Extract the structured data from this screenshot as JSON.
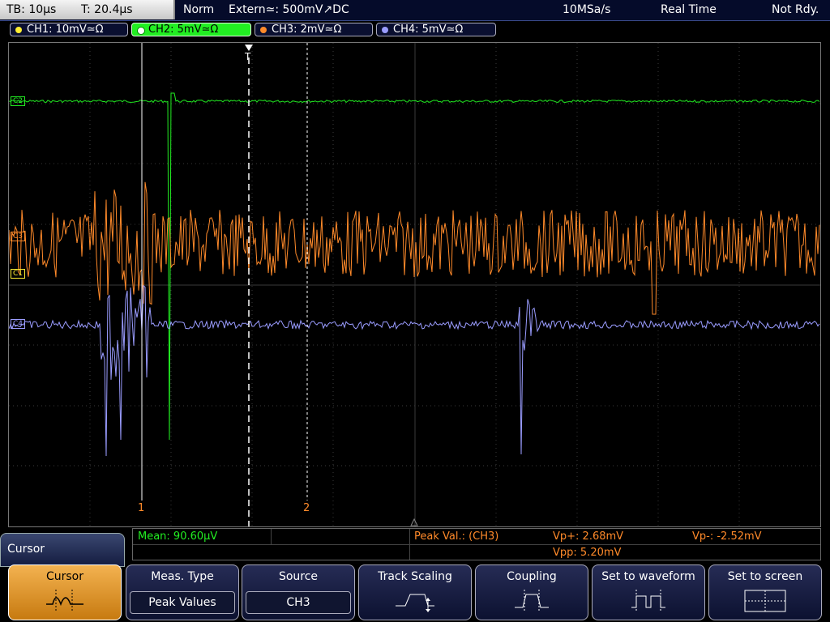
{
  "status": {
    "timebase": "TB: 10µs",
    "trigger_time": "T: 20.4µs",
    "mode": "Norm",
    "trigger": "Extern≃: 500mV↗DC",
    "sample_rate": "10MSa/s",
    "acquisition": "Real Time",
    "state": "Not Rdy."
  },
  "channels": [
    {
      "label": "CH1: 10mV≃Ω",
      "color": "#ffee33"
    },
    {
      "label": "CH2: 5mV≃Ω",
      "color": "#22ee22"
    },
    {
      "label": "CH3: 2mV≃Ω",
      "color": "#ff8a2a"
    },
    {
      "label": "CH4: 5mV≃Ω",
      "color": "#9a9cff"
    }
  ],
  "markers": {
    "ch2": "C2",
    "ch3": "C3",
    "ch1": "C1",
    "ch4": "C4",
    "trigger": "T",
    "cursor1": "1",
    "cursor2": "2"
  },
  "measurements": {
    "mean": "Mean: 90.60µV",
    "peak_label": "Peak Val.:  (CH3)",
    "vp_plus": "Vp+: 2.68mV",
    "vp_minus": "Vp-: -2.52mV",
    "vpp": "Vpp: 5.20mV"
  },
  "menu_title": "Cursor",
  "softkeys": {
    "cursor": "Cursor",
    "meas_type": "Meas. Type",
    "meas_type_value": "Peak Values",
    "source": "Source",
    "source_value": "CH3",
    "track_scaling": "Track Scaling",
    "coupling": "Coupling",
    "set_to_waveform": "Set to waveform",
    "set_to_screen": "Set to screen"
  },
  "colors": {
    "accent": "#f2a93b",
    "ch2": "#22ee22",
    "ch3": "#ff8a2a",
    "ch4": "#9a9cff",
    "ch1": "#ffee33"
  }
}
